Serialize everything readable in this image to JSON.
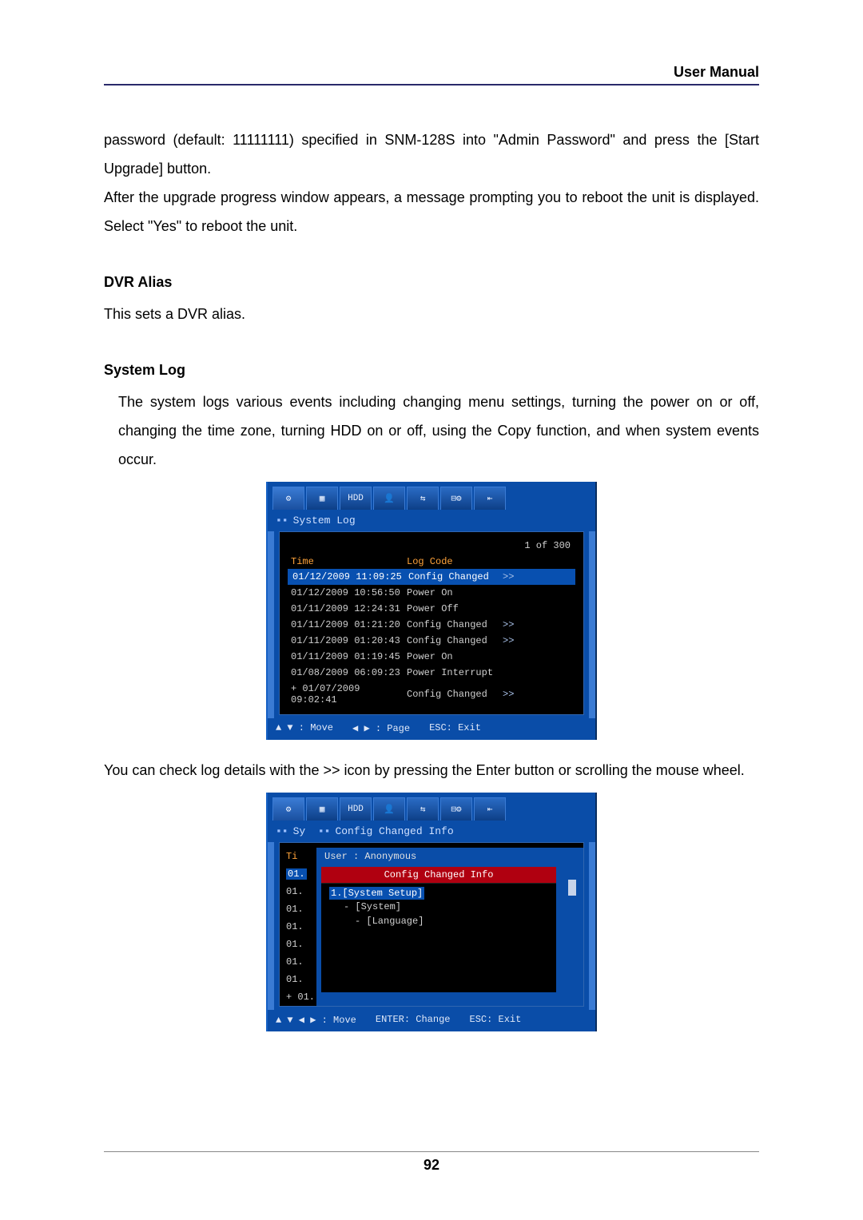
{
  "header": {
    "title": "User Manual"
  },
  "page_number": "92",
  "paragraphs": {
    "p1": "password (default: 11111111) specified in SNM-128S into \"Admin Password\" and press the [Start Upgrade] button.",
    "p2": "After the upgrade progress window appears, a message prompting you to reboot the unit is displayed. Select \"Yes\" to reboot the unit.",
    "dvr_alias_title": "DVR Alias",
    "dvr_alias_body": "This sets a DVR alias.",
    "system_log_title": "System Log",
    "system_log_body": "The system logs various events including changing menu settings, turning the power on or off, changing the time zone, turning HDD on or off, using the Copy function, and when system events occur.",
    "after_shot1": "You can check log details with the >> icon by pressing the Enter button or scrolling the mouse wheel."
  },
  "shot1": {
    "tabs": [
      "⚙",
      "▦",
      "HDD",
      "👤",
      "⇆",
      "⊟⚙",
      "⇤"
    ],
    "title": "System Log",
    "pager": "1 of 300",
    "col_time": "Time",
    "col_code": "Log Code",
    "rows": [
      {
        "t": "01/12/2009 11:09:25",
        "c": "Config Changed",
        "d": ">>",
        "sel": true
      },
      {
        "t": "01/12/2009 10:56:50",
        "c": "Power On",
        "d": ""
      },
      {
        "t": "01/11/2009 12:24:31",
        "c": "Power Off",
        "d": ""
      },
      {
        "t": "01/11/2009 01:21:20",
        "c": "Config Changed",
        "d": ">>"
      },
      {
        "t": "01/11/2009 01:20:43",
        "c": "Config Changed",
        "d": ">>"
      },
      {
        "t": "01/11/2009 01:19:45",
        "c": "Power On",
        "d": ""
      },
      {
        "t": "01/08/2009 06:09:23",
        "c": "Power Interrupt",
        "d": ""
      },
      {
        "t": "+ 01/07/2009 09:02:41",
        "c": "Config Changed",
        "d": ">>"
      }
    ],
    "footer": {
      "move": "▲ ▼ : Move",
      "page": "◀ ▶ : Page",
      "exit": "ESC: Exit"
    }
  },
  "shot2": {
    "tabs": [
      "⚙",
      "▦",
      "HDD",
      "👤",
      "⇆",
      "⊟⚙",
      "⇤"
    ],
    "left_prefix": "Sy",
    "title": "Config Changed Info",
    "user": "User : Anonymous",
    "header_bar": "Config Changed Info",
    "left_times": [
      "Ti",
      "01.",
      "01.",
      "01.",
      "01.",
      "01.",
      "01.",
      "01.",
      "+ 01."
    ],
    "items": {
      "l1": "1.[System Setup]",
      "l2": "- [System]",
      "l3": "- [Language]"
    },
    "footer": {
      "move": "▲ ▼ ◀ ▶ : Move",
      "enter": "ENTER: Change",
      "exit": "ESC: Exit"
    }
  }
}
